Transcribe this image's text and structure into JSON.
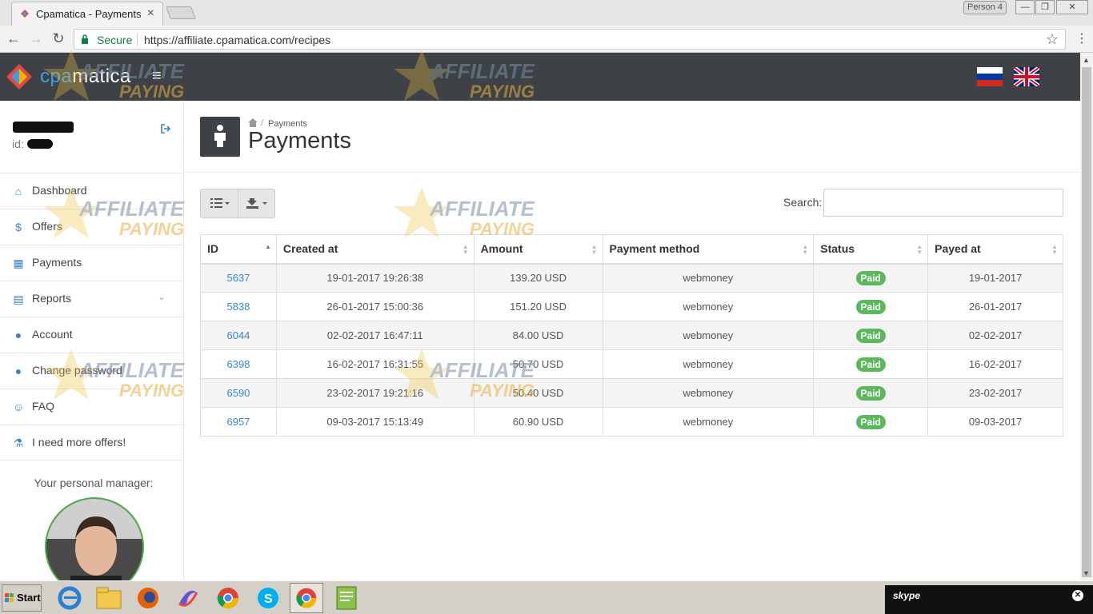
{
  "browser": {
    "tab_title": "Cpamatica - Payments",
    "profile": "Person 4",
    "secure_label": "Secure",
    "url": "https://affiliate.cpamatica.com/recipes"
  },
  "header": {
    "logo_prefix": "cpa",
    "logo_suffix": "matica"
  },
  "sidebar": {
    "id_label": "id:",
    "items": [
      {
        "label": "Dashboard",
        "icon": "home-icon"
      },
      {
        "label": "Offers",
        "icon": "dollar-icon"
      },
      {
        "label": "Payments",
        "icon": "calendar-icon"
      },
      {
        "label": "Reports",
        "icon": "document-icon"
      },
      {
        "label": "Account",
        "icon": "user-icon"
      },
      {
        "label": "Change password",
        "icon": "user-icon"
      },
      {
        "label": "FAQ",
        "icon": "reddit-icon"
      },
      {
        "label": "I need more offers!",
        "icon": "flask-icon"
      }
    ],
    "manager_label": "Your personal manager:"
  },
  "page": {
    "breadcrumb": "Payments",
    "title": "Payments"
  },
  "toolbar": {
    "search_label": "Search:"
  },
  "table": {
    "columns": [
      "ID",
      "Created at",
      "Amount",
      "Payment method",
      "Status",
      "Payed at"
    ],
    "rows": [
      {
        "id": "5637",
        "created": "19-01-2017 19:26:38",
        "amount": "139.20 USD",
        "method": "webmoney",
        "status": "Paid",
        "payed": "19-01-2017"
      },
      {
        "id": "5838",
        "created": "26-01-2017 15:00:36",
        "amount": "151.20 USD",
        "method": "webmoney",
        "status": "Paid",
        "payed": "26-01-2017"
      },
      {
        "id": "6044",
        "created": "02-02-2017 16:47:11",
        "amount": "84.00 USD",
        "method": "webmoney",
        "status": "Paid",
        "payed": "02-02-2017"
      },
      {
        "id": "6398",
        "created": "16-02-2017 16:31:55",
        "amount": "50.70 USD",
        "method": "webmoney",
        "status": "Paid",
        "payed": "16-02-2017"
      },
      {
        "id": "6590",
        "created": "23-02-2017 19:21:16",
        "amount": "50.40 USD",
        "method": "webmoney",
        "status": "Paid",
        "payed": "23-02-2017"
      },
      {
        "id": "6957",
        "created": "09-03-2017 15:13:49",
        "amount": "60.90 USD",
        "method": "webmoney",
        "status": "Paid",
        "payed": "09-03-2017"
      }
    ]
  },
  "taskbar": {
    "start_label": "Start",
    "skype_label": "skype"
  },
  "colors": {
    "header_bg": "#3e4246",
    "link": "#3a86c8",
    "paid_badge": "#5cb85c"
  }
}
